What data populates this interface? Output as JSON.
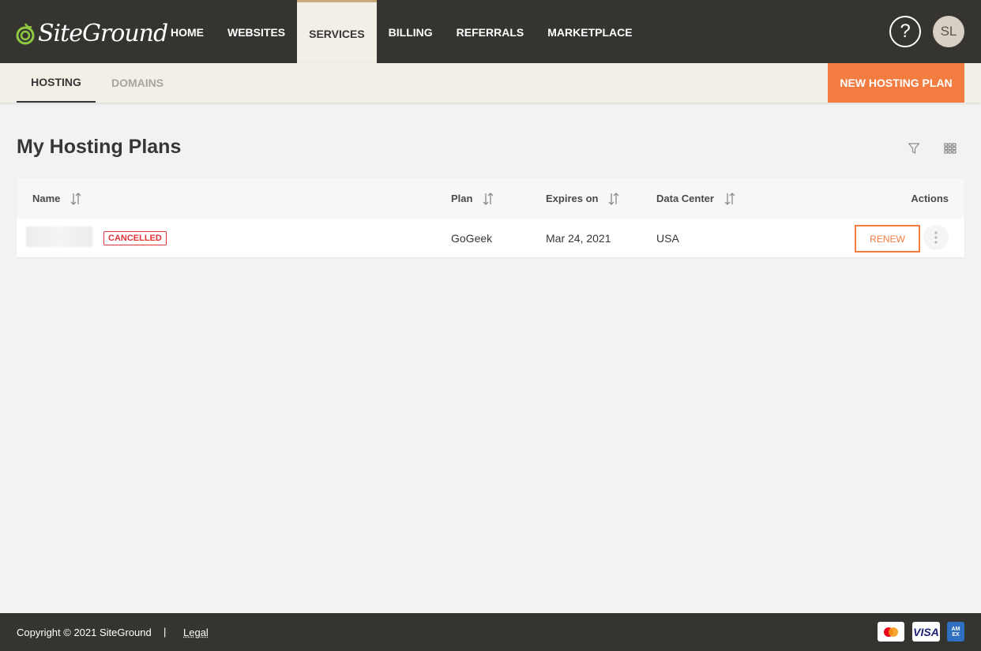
{
  "header": {
    "brand": "SiteGround",
    "nav": [
      {
        "label": "HOME"
      },
      {
        "label": "WEBSITES"
      },
      {
        "label": "SERVICES",
        "active": true
      },
      {
        "label": "BILLING"
      },
      {
        "label": "REFERRALS"
      },
      {
        "label": "MARKETPLACE"
      }
    ],
    "help_label": "?",
    "avatar_initials": "SL"
  },
  "subnav": {
    "tabs": [
      {
        "label": "HOSTING",
        "active": true
      },
      {
        "label": "DOMAINS"
      }
    ],
    "new_plan_button": "NEW HOSTING PLAN"
  },
  "main": {
    "title": "My Hosting Plans",
    "icons": [
      "filter-icon",
      "grid-view-icon"
    ],
    "table": {
      "columns": [
        "Name",
        "Plan",
        "Expires on",
        "Data Center",
        "Actions"
      ],
      "rows": [
        {
          "name": "",
          "status": "CANCELLED",
          "plan": "GoGeek",
          "expires": "Mar 24, 2021",
          "data_center": "USA",
          "action": "RENEW"
        }
      ]
    }
  },
  "footer": {
    "copyright": "Copyright © 2021 SiteGround",
    "divider": "|",
    "legal": "Legal",
    "payment_cards": [
      "mastercard-icon",
      "visa-icon",
      "amex-icon"
    ],
    "visa_label": "VISA",
    "amex_label": "AM EX"
  },
  "colors": {
    "header_bg": "#363431",
    "subnav_bg": "#f3efe7",
    "accent": "#f37c41",
    "danger": "#e0333a",
    "active_tab_border": "#c9a978"
  }
}
